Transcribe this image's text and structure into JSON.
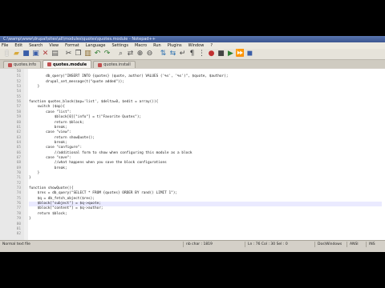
{
  "window": {
    "title": "C:\\wamp\\www\\drupal\\sites\\all\\modules\\quotes\\quotes.module - Notepad++"
  },
  "menu": [
    "File",
    "Edit",
    "Search",
    "View",
    "Format",
    "Language",
    "Settings",
    "Macro",
    "Run",
    "Plugins",
    "Window",
    "?"
  ],
  "tabs": [
    {
      "label": "quotes.info",
      "active": false
    },
    {
      "label": "quotes.module",
      "active": true
    },
    {
      "label": "quotes.install",
      "active": false
    }
  ],
  "editor": {
    "current_line": "73",
    "lines": [
      {
        "n": "50",
        "t": ""
      },
      {
        "n": "51",
        "t": "        db_query(\"INSERT INTO {quotes} (quote, author) VALUES ('%s', '%s')\", $quote, $author);"
      },
      {
        "n": "52",
        "t": "        drupal_set_message(t(\"quote added\"));"
      },
      {
        "n": "53",
        "t": "    }"
      },
      {
        "n": "54",
        "t": ""
      },
      {
        "n": "55",
        "t": ""
      },
      {
        "n": "56",
        "t": "function quotes_block($op='list', $delta=0, $edit = array()){"
      },
      {
        "n": "57",
        "t": "    switch ($op){"
      },
      {
        "n": "58",
        "t": "        case \"list\":"
      },
      {
        "n": "59",
        "t": "            $block[0][\"info\"] = t(\"Favorite Quotes\");"
      },
      {
        "n": "60",
        "t": "            return $block;"
      },
      {
        "n": "61",
        "t": "            break;"
      },
      {
        "n": "62",
        "t": "        case \"view\":"
      },
      {
        "n": "63",
        "t": "            return showQuote();"
      },
      {
        "n": "64",
        "t": "            break;"
      },
      {
        "n": "65",
        "t": "        case \"configure\":"
      },
      {
        "n": "66",
        "t": "            //additional form to show when configuring this module as a block"
      },
      {
        "n": "67",
        "t": "        case \"save\":"
      },
      {
        "n": "68",
        "t": "            //what happens when you save the block configurations"
      },
      {
        "n": "69",
        "t": "            break;"
      },
      {
        "n": "70",
        "t": "    }"
      },
      {
        "n": "71",
        "t": "}"
      },
      {
        "n": "72",
        "t": ""
      },
      {
        "n": "73",
        "t": "function showQuote(){"
      },
      {
        "n": "74",
        "t": "    $res = db_query(\"SELECT * FROM {quotes} ORDER BY rand() LIMIT 1\");"
      },
      {
        "n": "75",
        "t": "    $q = db_fetch_object($res);"
      },
      {
        "n": "76",
        "t": "    $block[\"subject\"] = $q->quote;"
      },
      {
        "n": "77",
        "t": "    $block[\"content\"] = $q->author;"
      },
      {
        "n": "78",
        "t": "    return $block;"
      },
      {
        "n": "79",
        "t": "}"
      },
      {
        "n": "80",
        "t": ""
      },
      {
        "n": "81",
        "t": ""
      },
      {
        "n": "82",
        "t": ""
      }
    ]
  },
  "status": {
    "file_type": "Normal text file",
    "length": "nb char : 1819",
    "position": "Ln : 76   Col : 30   Sel : 0",
    "eol": "Dos\\Windows",
    "encoding": "ANSI",
    "mode": "INS"
  }
}
